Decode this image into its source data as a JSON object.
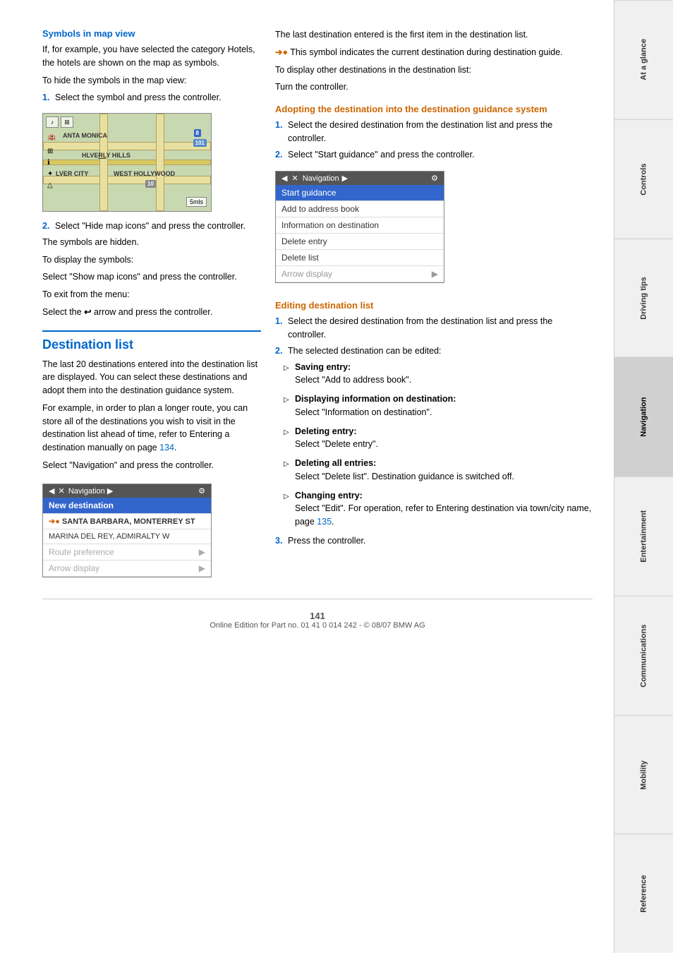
{
  "page": {
    "number": "141",
    "footer": "Online Edition for Part no. 01 41 0 014 242 - © 08/07 BMW AG"
  },
  "tabs": [
    {
      "id": "at-a-glance",
      "label": "At a glance",
      "active": false
    },
    {
      "id": "controls",
      "label": "Controls",
      "active": false
    },
    {
      "id": "driving-tips",
      "label": "Driving tips",
      "active": false
    },
    {
      "id": "navigation",
      "label": "Navigation",
      "active": true
    },
    {
      "id": "entertainment",
      "label": "Entertainment",
      "active": false
    },
    {
      "id": "communications",
      "label": "Communications",
      "active": false
    },
    {
      "id": "mobility",
      "label": "Mobility",
      "active": false
    },
    {
      "id": "reference",
      "label": "Reference",
      "active": false
    }
  ],
  "left_column": {
    "symbols_heading": "Symbols in map view",
    "symbols_para1": "If, for example, you have selected the category Hotels, the hotels are shown on the map as symbols.",
    "symbols_para2": "To hide the symbols in the map view:",
    "symbols_step1": "Select the symbol and press the controller.",
    "symbols_step2": "Select \"Hide map icons\" and press the controller.",
    "symbols_hidden": "The symbols are hidden.",
    "symbols_show_label": "To display the symbols:",
    "symbols_show_text": "Select \"Show map icons\" and press the controller.",
    "symbols_exit_label": "To exit from the menu:",
    "symbols_exit_text": "Select the",
    "symbols_exit_text2": "arrow and press the controller.",
    "dest_list_heading": "Destination list",
    "dest_list_para1": "The last 20 destinations entered into the destination list are displayed. You can select these destinations and adopt them into the destination guidance system.",
    "dest_list_para2": "For example, in order to plan a longer route, you can store all of the destinations you wish to visit in the destination list ahead of time, refer to Entering a destination manually on page",
    "dest_list_page_ref": "134",
    "dest_list_para3": "Select \"Navigation\" and press the controller.",
    "dest_menu": {
      "header": "Navigation",
      "items": [
        {
          "label": "New destination",
          "type": "selected"
        },
        {
          "label": "++SANTA BARBARA, MONTERREY ST",
          "type": "bold"
        },
        {
          "label": "MARINA DEL REY, ADMIRALTY W",
          "type": "normal"
        },
        {
          "label": "Route preference ▶",
          "type": "greyed-arrow"
        },
        {
          "label": "Arrow display ▶",
          "type": "greyed-arrow"
        }
      ]
    }
  },
  "right_column": {
    "dest_list_intro": "The last destination entered is the first item in the destination list.",
    "symbol_note": "This symbol indicates the current destination during destination guide.",
    "dest_display_label": "To display other destinations in the destination list:",
    "dest_display_text": "Turn the controller.",
    "adopting_heading": "Adopting the destination into the destination guidance system",
    "adopting_step1": "Select the desired destination from the destination list and press the controller.",
    "adopting_step2": "Select \"Start guidance\" and press the controller.",
    "nav_menu": {
      "header": "Navigation",
      "items": [
        {
          "label": "Start guidance",
          "type": "selected"
        },
        {
          "label": "Add to address book",
          "type": "normal"
        },
        {
          "label": "Information on destination",
          "type": "normal"
        },
        {
          "label": "Delete entry",
          "type": "normal"
        },
        {
          "label": "Delete list",
          "type": "normal"
        },
        {
          "label": "Arrow display ▶",
          "type": "arrow"
        }
      ]
    },
    "editing_heading": "Editing destination list",
    "editing_step1": "Select the desired destination from the destination list and press the controller.",
    "editing_step2_intro": "The selected destination can be edited:",
    "editing_bullets": [
      {
        "label": "Saving entry:",
        "text": "Select \"Add to address book\"."
      },
      {
        "label": "Displaying information on destination:",
        "text": "Select \"Information on destination\"."
      },
      {
        "label": "Deleting entry:",
        "text": "Select \"Delete entry\"."
      },
      {
        "label": "Deleting all entries:",
        "text": "Select \"Delete list\". Destination guidance is switched off."
      },
      {
        "label": "Changing entry:",
        "text": "Select \"Edit\". For operation, refer to Entering destination via town/city name, page"
      }
    ],
    "editing_page_ref": "135",
    "editing_step3": "Press the controller."
  },
  "map": {
    "labels": [
      "ANTA MONICA",
      "HLVERLY HILLS",
      "LVER CITY",
      "WEST HOLLYWOOD"
    ],
    "badge1": "8",
    "badge2": "101",
    "scale": "5mls",
    "route_badge": "10"
  }
}
